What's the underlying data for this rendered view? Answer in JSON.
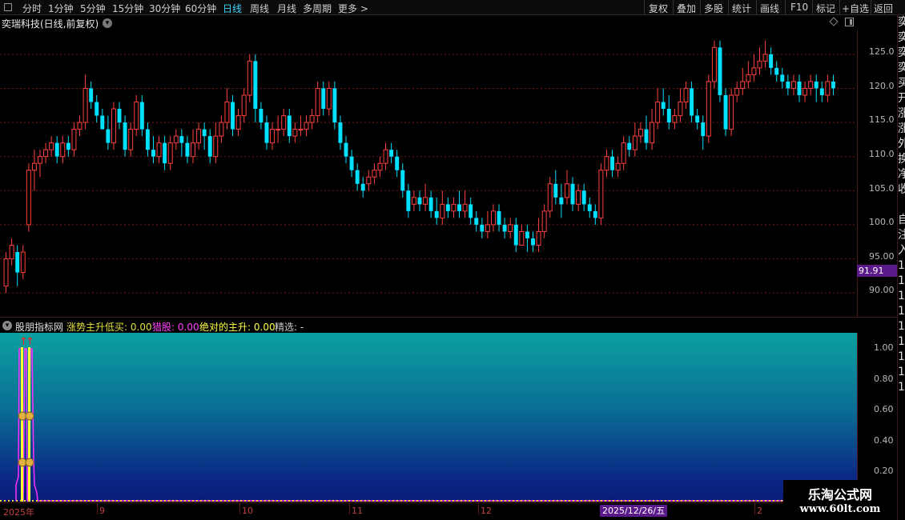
{
  "toolbar": {
    "periods": [
      "分时",
      "1分钟",
      "5分钟",
      "15分钟",
      "30分钟",
      "60分钟",
      "日线",
      "周线",
      "月线",
      "多周期",
      "更多"
    ],
    "active_period": "日线",
    "more_arrow": ">",
    "right_buttons": [
      "复权",
      "叠加",
      "多股",
      "统计",
      "画线",
      "F10",
      "标记",
      "+自选",
      "返回"
    ]
  },
  "stock": {
    "title": "奕瑞科技(日线,前复权)"
  },
  "price_axis": {
    "ticks": [
      "125.0",
      "120.0",
      "115.0",
      "110.0",
      "105.0",
      "100.0",
      "95.00",
      "90.00"
    ],
    "last_price": "91.91"
  },
  "right_strip": {
    "chars": [
      "奕",
      "奕",
      "奕",
      "奕",
      "买",
      "开",
      "涨",
      "涨",
      "外",
      "换",
      "净",
      "收",
      "",
      "自",
      "注",
      "入",
      "1",
      "1",
      "1",
      "1",
      "1",
      "1",
      "1",
      "1",
      "1"
    ]
  },
  "indicator": {
    "name": "股朋指标网",
    "fields": [
      {
        "label": "涨势主升低买:",
        "value": "0.00",
        "color": "#e0e040"
      },
      {
        "label": "猎股:",
        "value": "0.00",
        "color": "#ff40ff"
      },
      {
        "label": "绝对的主升:",
        "value": "0.00",
        "color": "#ffff40"
      },
      {
        "label": "精选:",
        "value": "-",
        "color": "#d0d0d0"
      }
    ],
    "ticks": [
      "1.00",
      "0.80",
      "0.60",
      "0.40",
      "0.20"
    ]
  },
  "date_axis": {
    "labels": [
      "2025年",
      "9",
      "10",
      "11",
      "12",
      "1",
      "2"
    ],
    "cursor_date": "2025/12/26/五"
  },
  "watermark": {
    "title": "乐淘公式网",
    "url": "www.60lt.com"
  },
  "colors": {
    "up": "#ff4040",
    "down": "#00e0ff",
    "grid": "#7a1818",
    "active": "#3fd3ff"
  },
  "chart_data": {
    "type": "candlestick",
    "ylim": [
      86.5,
      128.5
    ],
    "candles": [
      [
        91,
        95,
        92,
        96,
        90
      ],
      [
        95,
        97,
        96,
        98,
        94
      ],
      [
        96,
        93,
        92,
        97,
        91
      ],
      [
        93,
        96,
        95,
        97,
        92
      ],
      [
        100,
        108,
        108,
        109,
        99
      ],
      [
        108,
        109,
        109,
        111,
        105
      ],
      [
        109,
        110,
        110,
        111,
        107
      ],
      [
        110,
        111,
        111,
        112,
        109
      ],
      [
        111,
        112,
        112,
        113,
        110
      ],
      [
        112,
        110,
        111,
        113,
        109
      ],
      [
        110,
        112,
        112,
        113,
        109
      ],
      [
        112,
        111,
        111,
        113,
        110
      ],
      [
        111,
        114,
        114,
        115,
        110
      ],
      [
        114,
        115,
        115,
        116,
        113
      ],
      [
        115,
        120,
        120,
        122,
        114
      ],
      [
        120,
        118,
        118,
        121,
        117
      ],
      [
        118,
        116,
        117,
        119,
        115
      ],
      [
        116,
        114,
        115,
        117,
        114
      ],
      [
        114,
        112,
        113,
        116,
        111
      ],
      [
        112,
        117,
        117,
        118,
        111
      ],
      [
        117,
        115,
        115,
        118,
        114
      ],
      [
        115,
        111,
        111,
        116,
        110
      ],
      [
        111,
        114,
        114,
        115,
        110
      ],
      [
        114,
        118,
        118,
        119,
        113
      ],
      [
        118,
        114,
        114,
        119,
        113
      ],
      [
        114,
        111,
        112,
        115,
        110
      ],
      [
        111,
        110,
        110,
        113,
        109
      ],
      [
        110,
        112,
        112,
        113,
        109
      ],
      [
        112,
        109,
        110,
        113,
        108
      ],
      [
        109,
        112,
        112,
        113,
        108
      ],
      [
        112,
        113,
        113,
        114,
        111
      ],
      [
        113,
        112,
        112,
        114,
        110
      ],
      [
        112,
        110,
        110,
        113,
        109
      ],
      [
        110,
        112,
        112,
        114,
        109
      ],
      [
        112,
        114,
        114,
        115,
        111
      ],
      [
        114,
        113,
        113,
        115,
        111
      ],
      [
        113,
        110,
        111,
        114,
        109
      ],
      [
        110,
        113,
        113,
        115,
        109
      ],
      [
        113,
        115,
        115,
        116,
        112
      ],
      [
        115,
        118,
        118,
        120,
        114
      ],
      [
        118,
        114,
        114,
        119,
        113
      ],
      [
        114,
        116,
        116,
        117,
        113
      ],
      [
        116,
        119,
        119,
        120,
        115
      ],
      [
        119,
        124,
        124,
        125,
        118
      ],
      [
        124,
        117,
        117,
        125,
        115
      ],
      [
        117,
        115,
        115,
        118,
        114
      ],
      [
        115,
        112,
        112,
        116,
        111
      ],
      [
        112,
        114,
        114,
        115,
        111
      ],
      [
        114,
        114,
        114,
        116,
        112
      ],
      [
        114,
        116,
        116,
        117,
        113
      ],
      [
        116,
        113,
        113,
        117,
        112
      ],
      [
        113,
        114,
        114,
        115,
        112
      ],
      [
        114,
        114,
        114,
        116,
        113
      ],
      [
        114,
        115,
        115,
        116,
        113
      ],
      [
        115,
        116,
        116,
        117,
        114
      ],
      [
        116,
        120,
        120,
        121,
        115
      ],
      [
        120,
        117,
        117,
        121,
        116
      ],
      [
        117,
        120,
        120,
        121,
        116
      ],
      [
        120,
        115,
        115,
        121,
        114
      ],
      [
        115,
        112,
        112,
        116,
        111
      ],
      [
        112,
        110,
        110,
        113,
        109
      ],
      [
        110,
        108,
        108,
        111,
        107
      ],
      [
        108,
        106,
        106,
        109,
        105
      ],
      [
        106,
        105,
        106,
        107,
        104
      ],
      [
        106,
        107,
        107,
        108,
        105
      ],
      [
        107,
        108,
        108,
        109,
        106
      ],
      [
        108,
        109,
        109,
        110,
        107
      ],
      [
        109,
        111,
        111,
        112,
        108
      ],
      [
        111,
        110,
        110,
        112,
        109
      ],
      [
        110,
        108,
        108,
        111,
        107
      ],
      [
        108,
        105,
        105,
        109,
        104
      ],
      [
        105,
        102,
        103,
        106,
        101
      ],
      [
        103,
        104,
        104,
        105,
        102
      ],
      [
        104,
        103,
        103,
        105,
        102
      ],
      [
        103,
        104,
        104,
        106,
        102
      ],
      [
        104,
        102,
        102,
        105,
        101
      ],
      [
        102,
        101,
        101,
        104,
        100
      ],
      [
        101,
        103,
        103,
        105,
        100
      ],
      [
        103,
        102,
        102,
        104,
        101
      ],
      [
        102,
        103,
        103,
        104,
        101
      ],
      [
        103,
        102,
        102,
        105,
        101
      ],
      [
        102,
        103,
        103,
        105,
        101
      ],
      [
        103,
        101,
        101,
        104,
        100
      ],
      [
        101,
        100,
        100,
        102,
        99
      ],
      [
        100,
        99,
        99,
        101,
        98
      ],
      [
        99,
        100,
        100,
        102,
        98
      ],
      [
        100,
        102,
        102,
        103,
        99
      ],
      [
        102,
        100,
        100,
        103,
        99
      ],
      [
        100,
        99,
        99,
        101,
        98
      ],
      [
        99,
        100,
        100,
        101,
        98
      ],
      [
        100,
        97,
        97,
        101,
        96
      ],
      [
        97,
        99,
        99,
        100,
        97
      ],
      [
        99,
        98,
        98,
        100,
        96
      ],
      [
        98,
        97,
        97,
        99,
        96
      ],
      [
        97,
        99,
        99,
        101,
        96
      ],
      [
        99,
        102,
        102,
        103,
        98
      ],
      [
        102,
        106,
        106,
        107,
        101
      ],
      [
        106,
        104,
        104,
        108,
        103
      ],
      [
        104,
        103,
        104,
        106,
        101
      ],
      [
        104,
        106,
        106,
        108,
        103
      ],
      [
        106,
        103,
        103,
        107,
        102
      ],
      [
        103,
        105,
        105,
        106,
        102
      ],
      [
        105,
        103,
        103,
        106,
        102
      ],
      [
        103,
        102,
        102,
        104,
        101
      ],
      [
        102,
        101,
        101,
        103,
        100
      ],
      [
        101,
        108,
        108,
        109,
        100
      ],
      [
        108,
        110,
        110,
        111,
        107
      ],
      [
        110,
        108,
        108,
        111,
        107
      ],
      [
        108,
        109,
        109,
        110,
        107
      ],
      [
        109,
        112,
        112,
        113,
        108
      ],
      [
        112,
        111,
        111,
        113,
        110
      ],
      [
        111,
        113,
        113,
        115,
        110
      ],
      [
        113,
        114,
        114,
        115,
        112
      ],
      [
        114,
        112,
        112,
        116,
        111
      ],
      [
        112,
        115,
        115,
        117,
        111
      ],
      [
        115,
        118,
        118,
        120,
        114
      ],
      [
        118,
        117,
        117,
        120,
        116
      ],
      [
        117,
        115,
        115,
        119,
        114
      ],
      [
        115,
        116,
        116,
        117,
        114
      ],
      [
        116,
        118,
        118,
        120,
        115
      ],
      [
        118,
        120,
        120,
        121,
        117
      ],
      [
        120,
        116,
        116,
        121,
        115
      ],
      [
        116,
        115,
        115,
        117,
        114
      ],
      [
        115,
        113,
        113,
        116,
        111
      ],
      [
        113,
        121,
        121,
        122,
        112
      ],
      [
        121,
        126,
        126,
        127,
        120
      ],
      [
        126,
        119,
        119,
        127,
        118
      ],
      [
        119,
        114,
        114,
        120,
        113
      ],
      [
        114,
        119,
        119,
        120,
        113
      ],
      [
        119,
        120,
        120,
        121,
        118
      ],
      [
        120,
        121,
        121,
        123,
        119
      ],
      [
        121,
        122,
        122,
        124,
        120
      ],
      [
        122,
        123,
        123,
        125,
        121
      ],
      [
        123,
        124,
        124,
        126,
        122
      ],
      [
        124,
        125,
        125,
        127,
        123
      ],
      [
        125,
        123,
        123,
        126,
        122
      ],
      [
        123,
        122,
        122,
        124,
        121
      ],
      [
        122,
        121,
        121,
        123,
        120
      ],
      [
        121,
        120,
        120,
        122,
        119
      ],
      [
        120,
        121,
        121,
        122,
        119
      ],
      [
        121,
        119,
        119,
        122,
        118
      ],
      [
        119,
        120,
        120,
        121,
        118
      ],
      [
        120,
        121,
        121,
        122,
        119
      ],
      [
        121,
        120,
        120,
        122,
        118
      ],
      [
        120,
        119,
        119,
        121,
        118
      ],
      [
        119,
        121,
        121,
        122,
        118
      ],
      [
        121,
        120,
        120,
        122,
        119
      ]
    ]
  }
}
